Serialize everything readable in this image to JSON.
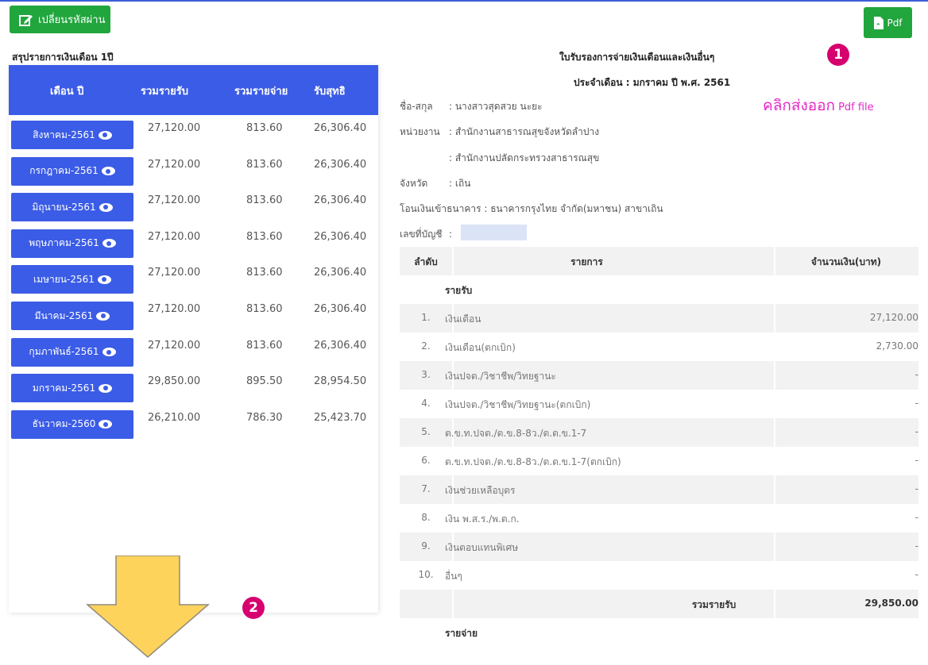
{
  "buttons": {
    "change_password": "เปลี่ยนรหัสผ่าน",
    "pdf": "Pdf"
  },
  "left": {
    "title": "สรุปรายการเงินเดือน 1ปี",
    "columns": [
      "เดือน ปี",
      "รวมรายรับ",
      "รวมรายจ่าย",
      "รับสุทธิ"
    ],
    "rows": [
      {
        "month": "สิงหาคม-2561",
        "income": "27,120.00",
        "expense": "813.60",
        "net": "26,306.40"
      },
      {
        "month": "กรกฎาคม-2561",
        "income": "27,120.00",
        "expense": "813.60",
        "net": "26,306.40"
      },
      {
        "month": "มิถุนายน-2561",
        "income": "27,120.00",
        "expense": "813.60",
        "net": "26,306.40"
      },
      {
        "month": "พฤษภาคม-2561",
        "income": "27,120.00",
        "expense": "813.60",
        "net": "26,306.40"
      },
      {
        "month": "เมษายน-2561",
        "income": "27,120.00",
        "expense": "813.60",
        "net": "26,306.40"
      },
      {
        "month": "มีนาคม-2561",
        "income": "27,120.00",
        "expense": "813.60",
        "net": "26,306.40"
      },
      {
        "month": "กุมภาพันธ์-2561",
        "income": "27,120.00",
        "expense": "813.60",
        "net": "26,306.40"
      },
      {
        "month": "มกราคม-2561",
        "income": "29,850.00",
        "expense": "895.50",
        "net": "28,954.50"
      },
      {
        "month": "ธันวาคม-2560",
        "income": "26,210.00",
        "expense": "786.30",
        "net": "25,423.70"
      }
    ]
  },
  "annotations": {
    "badge1": "1",
    "badge2": "2",
    "pdf_note": "คลิกส่งออก",
    "pdf_note_small": "Pdf file",
    "accent": "#e528c6",
    "arrow_color": "#fdd35c"
  },
  "slip": {
    "title": "ใบรับรองการจ่ายเงินเดือนและเงินอื่นๆ",
    "subtitle": "ประจำเดือน : มกราคม ปี พ.ศ. 2561",
    "name_label": "ชื่อ-สกุล",
    "name_value": ": นางสาวสุดสวย นะยะ",
    "unit_label": "หน่วยงาน",
    "unit_value": ": สำนักงานสาธารณสุขจังหวัดลำปาง",
    "unit_value2": ": สำนักงานปลัดกระทรวงสาธารณสุข",
    "province_label": "จังหวัด",
    "province_value": ": เถิน",
    "bank_line": "โอนเงินเข้าธนาคาร : ธนาคารกรุงไทย จำกัด(มหาชน) สาขาเถิน",
    "account_label": "เลขที่บัญชี",
    "account_value": ":",
    "table_headers": [
      "ลำดับ",
      "รายการ",
      "จำนวนเงิน(บาท)"
    ],
    "income_section": "รายรับ",
    "items": [
      {
        "no": "1.",
        "name": "เงินเดือน",
        "amount": "27,120.00"
      },
      {
        "no": "2.",
        "name": "เงินเดือน(ตกเบิก)",
        "amount": "2,730.00"
      },
      {
        "no": "3.",
        "name": "เงินปจต./วิชาชีพ/วิทยฐานะ",
        "amount": "-"
      },
      {
        "no": "4.",
        "name": "เงินปจต./วิชาชีพ/วิทยฐานะ(ตกเบิก)",
        "amount": "-"
      },
      {
        "no": "5.",
        "name": "ต.ข.ท.ปจต./ต.ข.8-8ว./ต.ต.ข.1-7",
        "amount": "-"
      },
      {
        "no": "6.",
        "name": "ต.ข.ท.ปจต./ต.ข.8-8ว./ต.ต.ข.1-7(ตกเบิก)",
        "amount": "-"
      },
      {
        "no": "7.",
        "name": "เงินช่วยเหลือบุตร",
        "amount": "-"
      },
      {
        "no": "8.",
        "name": "เงิน พ.ส.ร./พ.ต.ก.",
        "amount": "-"
      },
      {
        "no": "9.",
        "name": "เงินตอบแทนพิเศษ",
        "amount": "-"
      },
      {
        "no": "10.",
        "name": "อื่นๆ",
        "amount": "-"
      }
    ],
    "total_income_label": "รวมรายรับ",
    "total_income_value": "29,850.00",
    "expense_section": "รายจ่าย"
  }
}
